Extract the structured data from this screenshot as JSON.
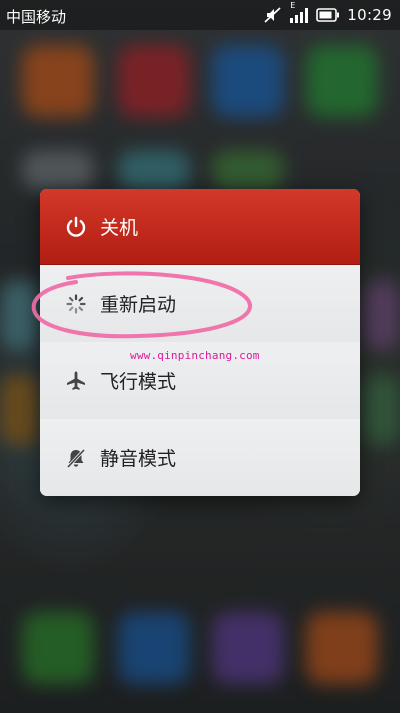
{
  "status_bar": {
    "carrier": "中国移动",
    "time": "10:29",
    "network_type": "E",
    "icons": [
      "mute-icon",
      "signal-icon",
      "battery-icon"
    ]
  },
  "power_menu": {
    "header": {
      "label": "关机",
      "icon": "power-icon"
    },
    "items": [
      {
        "label": "重新启动",
        "icon": "spinner-icon"
      },
      {
        "label": "飞行模式",
        "icon": "airplane-icon"
      },
      {
        "label": "静音模式",
        "icon": "muted-bell-icon"
      }
    ]
  },
  "watermark": {
    "text": "www.qinpinchang.com"
  },
  "colors": {
    "header_red": "#c1291c",
    "menu_background": "#e9eaec",
    "annotation_pink": "#f06aa6",
    "watermark_magenta": "#e0199a"
  }
}
